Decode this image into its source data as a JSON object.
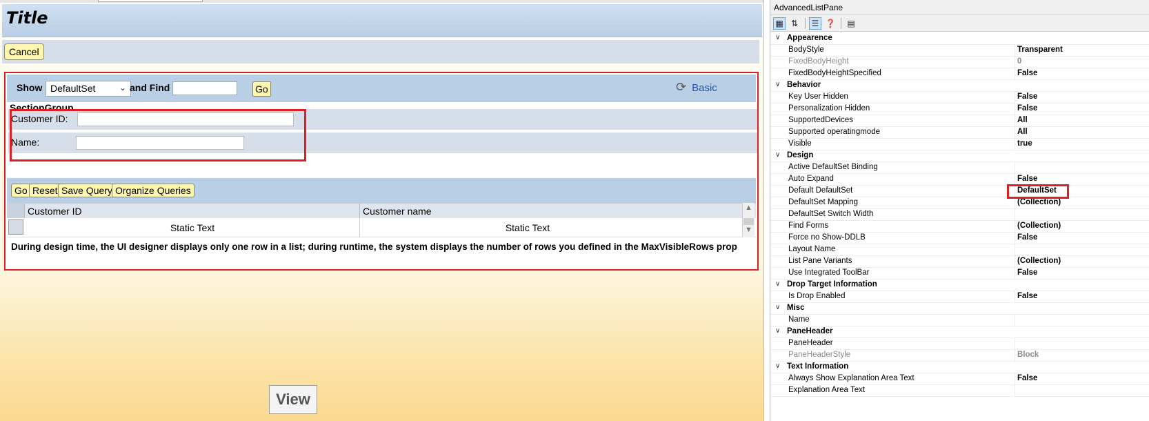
{
  "designer": {
    "title": "Title",
    "cancel_label": "Cancel",
    "show_label": "Show",
    "show_select": "DefaultSet",
    "and_find_label": "and  Find",
    "go_label": "Go",
    "basic_label": "Basic",
    "section_group": "SectionGroup",
    "fields": [
      {
        "label": "Customer ID:"
      },
      {
        "label": "Name:"
      }
    ],
    "buttons": {
      "go": "Go",
      "reset": "Reset",
      "save_query": "Save Query",
      "organize_queries": "Organize Queries"
    },
    "grid": {
      "columns": [
        "Customer ID",
        "Customer name"
      ],
      "rows": [
        [
          "Static Text",
          "Static Text"
        ]
      ]
    },
    "info_text": "During design time, the UI designer displays only one row in a list; during runtime, the system displays the number of rows you defined in the MaxVisibleRows prop",
    "view_label": "View"
  },
  "properties": {
    "title": "AdvancedListPane",
    "rows": [
      {
        "type": "cat",
        "name": "Appearence"
      },
      {
        "name": "BodyStyle",
        "value": "Transparent"
      },
      {
        "name": "FixedBodyHeight",
        "value": "0",
        "dim": true
      },
      {
        "name": "FixedBodyHeightSpecified",
        "value": "False"
      },
      {
        "type": "cat",
        "name": "Behavior"
      },
      {
        "name": "Key User Hidden",
        "value": "False"
      },
      {
        "name": "Personalization Hidden",
        "value": "False"
      },
      {
        "name": "SupportedDevices",
        "value": "All"
      },
      {
        "name": "Supported operatingmode",
        "value": "All"
      },
      {
        "name": "Visible",
        "value": "true"
      },
      {
        "type": "cat",
        "name": "Design"
      },
      {
        "name": "Active DefaultSet Binding",
        "value": ""
      },
      {
        "name": "Auto Expand",
        "value": "False"
      },
      {
        "name": "Default DefaultSet",
        "value": "DefaultSet"
      },
      {
        "name": "DefaultSet Mapping",
        "value": "(Collection)"
      },
      {
        "name": "DefaultSet Switch Width",
        "value": ""
      },
      {
        "name": "Find Forms",
        "value": "(Collection)"
      },
      {
        "name": "Force no Show-DDLB",
        "value": "False"
      },
      {
        "name": "Layout Name",
        "value": ""
      },
      {
        "name": "List Pane Variants",
        "value": "(Collection)"
      },
      {
        "name": "Use Integrated ToolBar",
        "value": "False"
      },
      {
        "type": "cat",
        "name": "Drop Target Information"
      },
      {
        "name": "Is Drop Enabled",
        "value": "False"
      },
      {
        "type": "cat",
        "name": "Misc"
      },
      {
        "name": "Name",
        "value": ""
      },
      {
        "type": "cat",
        "name": "PaneHeader"
      },
      {
        "name": "PaneHeader",
        "value": ""
      },
      {
        "name": "PaneHeaderStyle",
        "value": "Block",
        "dim": true
      },
      {
        "type": "cat",
        "name": "Text Information"
      },
      {
        "name": "Always Show Explanation Area Text",
        "value": "False"
      },
      {
        "name": "Explanation Area Text",
        "value": ""
      }
    ]
  },
  "colors": {
    "highlight": "#e02020",
    "sap_header": "#b9cfe6",
    "button": "#fff7b0"
  }
}
